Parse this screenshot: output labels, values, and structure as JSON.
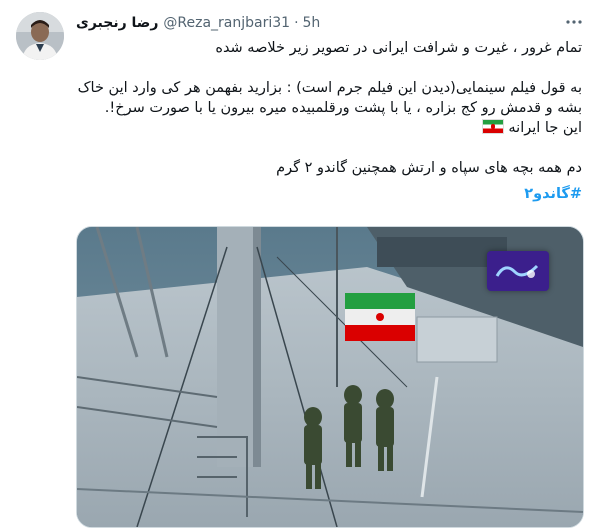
{
  "tweet": {
    "display_name": "رضا رنجبری",
    "handle": "@Reza_ranjbari31",
    "separator": "·",
    "time": "5h",
    "lines": [
      "تمام غرور ، غیرت و شرافت ایرانی در تصویر زیر خلاصه شده",
      "به قول فیلم سینمایی(دیدن این فیلم جرم است) : بزارید بفهمن هر کی وارد این خاک بشه و قدمش رو کج بزاره ، یا با پشت ورقلمبیده میره بیرون یا با صورت سرخ!.",
      "این جا ایرانه",
      "دم همه بچه های سپاه و ارتش همچنین گاندو ۲ گرم"
    ],
    "hashtag": "#گاندو۲"
  },
  "icons": {
    "more": "more-horizontal-icon",
    "flag": "iran-flag-emoji-icon"
  },
  "colors": {
    "text": "#0f1419",
    "secondary": "#536471",
    "link": "#1d9bf0",
    "flag_green": "#239f40",
    "flag_red": "#da0000"
  }
}
